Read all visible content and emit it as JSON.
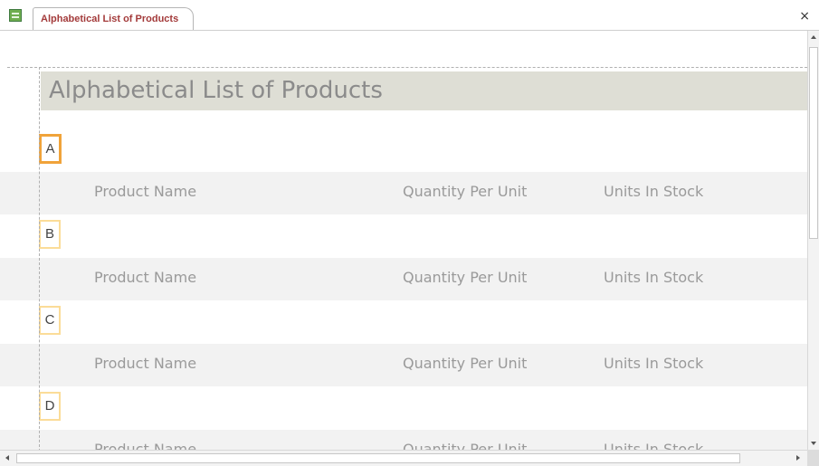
{
  "tab": {
    "title": "Alphabetical List of Products",
    "close_glyph": "×"
  },
  "report": {
    "title": "Alphabetical List of Products",
    "columns": {
      "product_name": "Product Name",
      "quantity_per_unit": "Quantity Per Unit",
      "units_in_stock": "Units In Stock"
    },
    "groups": [
      {
        "letter": "A",
        "selected": true
      },
      {
        "letter": "B",
        "selected": false
      },
      {
        "letter": "C",
        "selected": false
      },
      {
        "letter": "D",
        "selected": false
      }
    ]
  },
  "colors": {
    "tab_title": "#a33a3a",
    "title_band": "#deded5",
    "selected_outline": "#f0a33a",
    "group_outline": "#fbdc98",
    "alt_band": "#f2f2f2"
  },
  "icons": {
    "document": "report-document-icon",
    "close": "close-icon"
  }
}
